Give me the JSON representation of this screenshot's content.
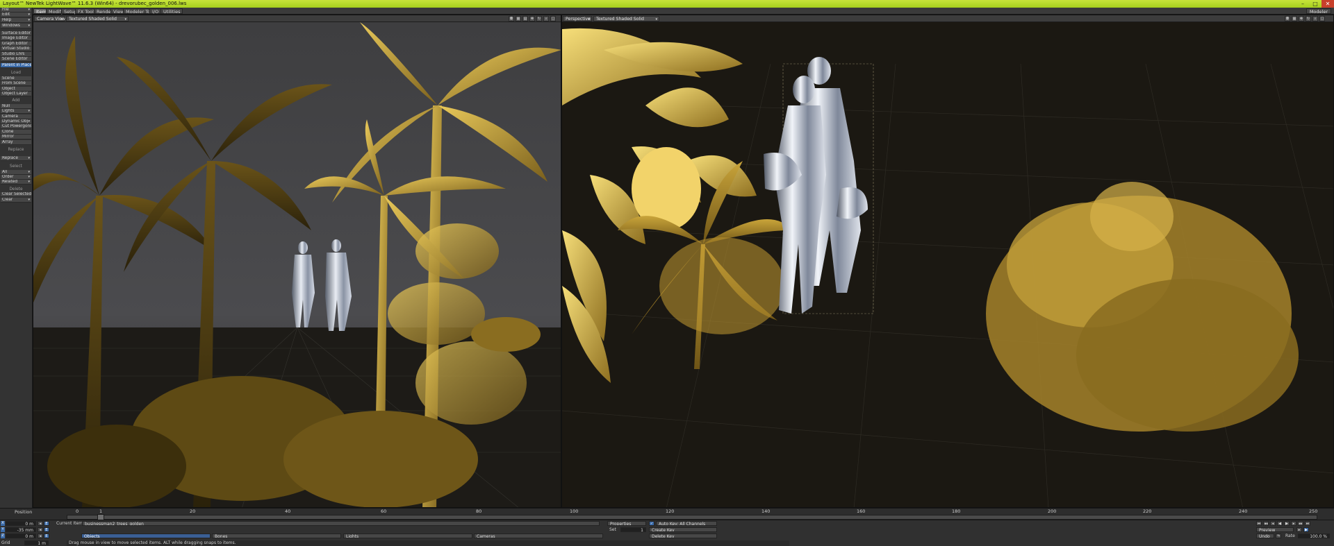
{
  "app": {
    "title": "Layout™ NewTek LightWave™ 11.6.3 (Win64) - drevorubec_golden_006.lws",
    "window_buttons": [
      "–",
      "□",
      "✕"
    ]
  },
  "tabs": [
    "Items",
    "Modify",
    "Setup",
    "FX Tools",
    "Render",
    "View",
    "Modeler Tools",
    "I/O",
    "Utilities"
  ],
  "active_tab": "Items",
  "modeler_button": "Modeler",
  "left_toolbar": {
    "top_menus": [
      "File",
      "Edit",
      "Help",
      "Windows"
    ],
    "editors": [
      "Surface Editor",
      "Image Editor",
      "Graph Editor",
      "Virtual Studio",
      "Studio LIVE",
      "Scene Editor"
    ],
    "parent_in_place": "Parent in Place",
    "load_header": "Load",
    "load_items": [
      "Scene",
      "From Scene",
      "Object",
      "Object Layer"
    ],
    "add_header": "Add",
    "add_items": [
      "Null",
      "Lights",
      "Camera",
      "Dynamic Obj",
      "Cut Powergons",
      "Clone",
      "Mirror",
      "Array"
    ],
    "replace_header": "Replace",
    "replace_items": [
      "Replace"
    ],
    "select_header": "Select",
    "select_items": [
      "All",
      "Order",
      "Related"
    ],
    "delete_header": "Delete",
    "delete_items": [
      "Clear Selected",
      "Clear"
    ]
  },
  "viewport_left": {
    "view": "Camera View",
    "shading": "Textured Shaded Solid"
  },
  "viewport_right": {
    "view": "Perspective",
    "shading": "Textured Shaded Solid"
  },
  "timeline": {
    "position_label": "Position",
    "ticks": [
      "0",
      "20",
      "40",
      "60",
      "80",
      "100",
      "120",
      "140",
      "160",
      "180",
      "200",
      "220",
      "240",
      "250"
    ],
    "current_frame": "1"
  },
  "bottom": {
    "xyz": [
      {
        "axis": "X",
        "value": "0 m"
      },
      {
        "axis": "Y",
        "value": "-35 mm"
      },
      {
        "axis": "Z",
        "value": "0 m"
      }
    ],
    "grid_label": "Grid",
    "grid_value": "1 m",
    "current_item_label": "Current Item",
    "current_item": "businessman2_trees_golden",
    "objects_label": "Objects",
    "bones_label": "Bones",
    "lights_label": "Lights",
    "cameras_label": "Cameras",
    "properties": "Properties",
    "set": "Set",
    "set_value": "1",
    "auto_key": "Auto Key: All Channels",
    "create_key": "Create Key",
    "delete_key": "Delete Key",
    "preview": "Preview",
    "undo": "Undo",
    "rate_label": "Rate",
    "rate_value": "100.0 %",
    "status": "Drag mouse in view to move selected items. ALT while dragging snaps to items."
  },
  "colors": {
    "title_bar": "#b5d92a",
    "selection_blue": "#3a6aa8",
    "foliage_gold": "#c9a43a",
    "foliage_bright": "#f0d060",
    "chrome_silver": "#c8ccd6",
    "viewport_bg_left": "#4a4a4c",
    "viewport_bg_right": "#1a1711"
  }
}
